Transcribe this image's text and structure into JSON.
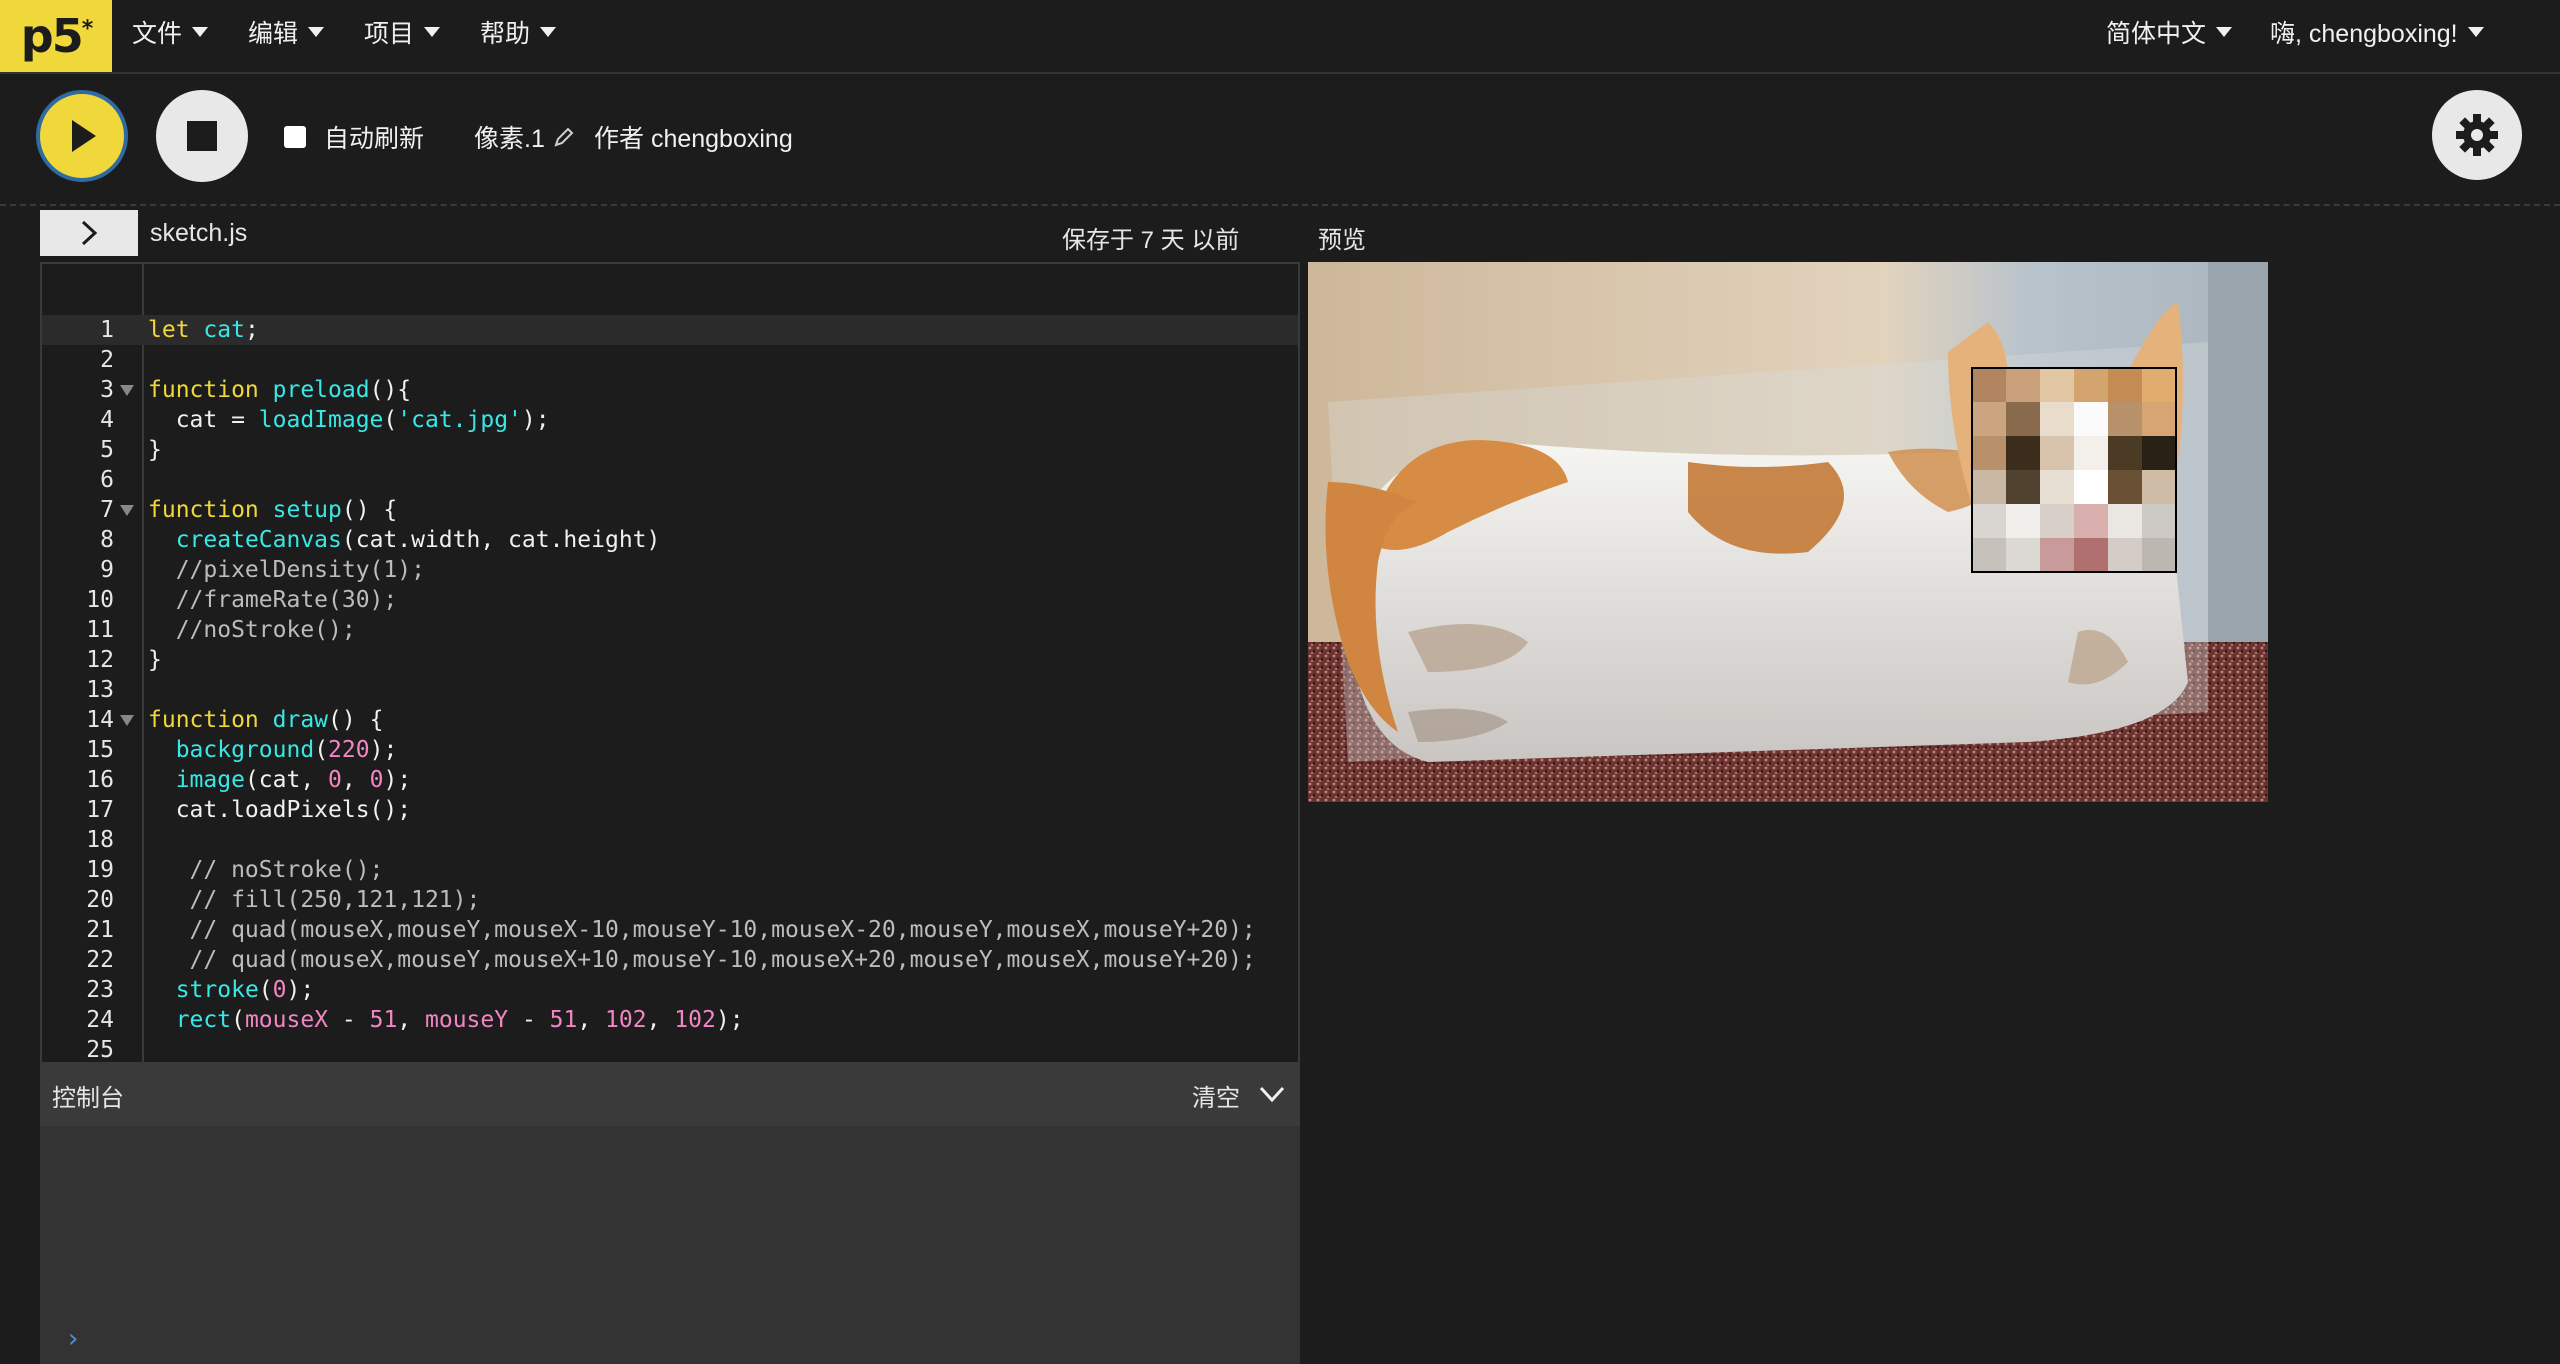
{
  "app": {
    "logo": "p5",
    "logo_sup": "*"
  },
  "menu": [
    {
      "label": "文件"
    },
    {
      "label": "编辑"
    },
    {
      "label": "项目"
    },
    {
      "label": "帮助"
    }
  ],
  "nav_right": {
    "language": "简体中文",
    "user": "嗨, chengboxing!"
  },
  "toolbar": {
    "autorefresh_label": "自动刷新",
    "autorefresh_checked": false,
    "sketch_name": "像素.1",
    "author": "作者 chengboxing"
  },
  "editor": {
    "filename": "sketch.js",
    "saved": "保存于 7 天 以前",
    "preview_label": "预览",
    "line_numbers": [
      "1",
      "2",
      "3",
      "4",
      "5",
      "6",
      "7",
      "8",
      "9",
      "10",
      "11",
      "12",
      "13",
      "14",
      "15",
      "16",
      "17",
      "18",
      "19",
      "20",
      "21",
      "22",
      "23",
      "24",
      "25"
    ],
    "lines": [
      "let cat;",
      "",
      "function preload(){",
      "  cat = loadImage('cat.jpg');",
      "}",
      "",
      "function setup() {",
      "  createCanvas(cat.width, cat.height)",
      "  //pixelDensity(1);",
      "  //frameRate(30);",
      "  //noStroke();",
      "}",
      "",
      "function draw() {",
      "  background(220);",
      "  image(cat, 0, 0);",
      "  cat.loadPixels();",
      "",
      "   // noStroke();",
      "   // fill(250,121,121);",
      "   // quad(mouseX,mouseY,mouseX-10,mouseY-10,mouseX-20,mouseY,mouseX,mouseY+20);",
      "   // quad(mouseX,mouseY,mouseX+10,mouseY-10,mouseX+20,mouseY,mouseX,mouseY+20);",
      "  stroke(0);",
      "  rect(mouseX - 51, mouseY - 51, 102, 102);",
      ""
    ]
  },
  "console": {
    "title": "控制台",
    "clear": "清空",
    "prompt": "›"
  },
  "colors": {
    "accent": "#f0d83a",
    "bg": "#1c1c1c",
    "keyword": "#f0d83a",
    "function": "#38e8e6",
    "number": "#f286c4"
  }
}
